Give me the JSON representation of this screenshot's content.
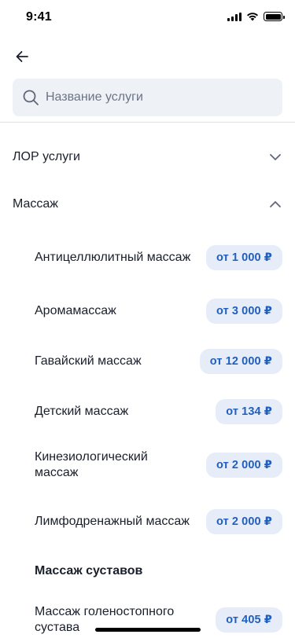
{
  "status_bar": {
    "time": "9:41"
  },
  "search": {
    "placeholder": "Название услуги"
  },
  "categories": [
    {
      "label": "ЛОР услуги",
      "state": "collapsed"
    },
    {
      "label": "Массаж",
      "state": "expanded"
    }
  ],
  "services": [
    {
      "name": "Антицеллюлитный массаж",
      "price": "от 1 000 ₽"
    },
    {
      "name": "Аромамассаж",
      "price": "от 3 000 ₽"
    },
    {
      "name": "Гавайский массаж",
      "price": "от 12 000 ₽"
    },
    {
      "name": "Детский массаж",
      "price": "от 134 ₽"
    },
    {
      "name": "Кинезиологический массаж",
      "price": "от 2 000 ₽"
    },
    {
      "name": "Лимфодренажный массаж",
      "price": "от 2 000 ₽"
    }
  ],
  "subgroup": {
    "title": "Массаж суставов",
    "services": [
      {
        "name": "Массаж голеностопного сустава",
        "price": "от 405 ₽"
      }
    ]
  },
  "colors": {
    "accent": "#1f5fbf",
    "badge_bg": "#e7edf8",
    "search_bg": "#eef1f6",
    "text": "#1a1f2b",
    "divider": "#dde1e8"
  },
  "icons": {
    "back": "arrow-left-icon",
    "search": "search-icon",
    "collapsed": "chevron-down-icon",
    "expanded": "chevron-up-icon"
  }
}
